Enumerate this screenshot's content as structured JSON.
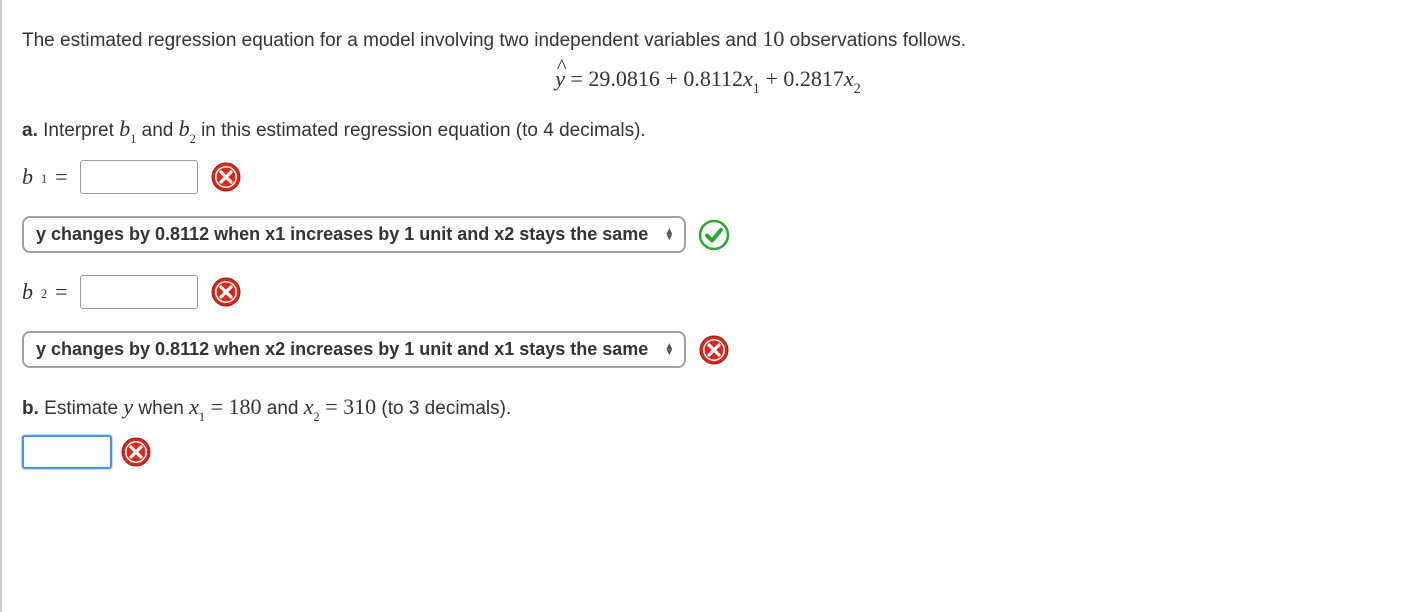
{
  "intro": {
    "pre": "The estimated regression equation for a model involving two independent variables and ",
    "n": "10",
    "post": " observations follows."
  },
  "equation": {
    "yhat": "ŷ",
    "eq": " = ",
    "c0": "29.0816",
    "plus1": " + ",
    "c1": "0.8112",
    "x1": "x",
    "x1s": "1",
    "plus2": " + ",
    "c2": "0.2817",
    "x2": "x",
    "x2s": "2"
  },
  "part_a": {
    "label": "a.",
    "text_pre": " Interpret ",
    "b1": "b",
    "b1s": "1",
    "and": " and ",
    "b2": "b",
    "b2s": "2",
    "text_post": " in this estimated regression equation (to 4 decimals)."
  },
  "b1_row": {
    "b": "b",
    "s": "1",
    "eq": "=",
    "value": ""
  },
  "select1": {
    "text": "y changes by 0.8112 when x1 increases by 1 unit and x2 stays the same"
  },
  "b2_row": {
    "b": "b",
    "s": "2",
    "eq": "=",
    "value": ""
  },
  "select2": {
    "text": "y changes by 0.8112 when x2 increases by 1 unit and x1 stays the same"
  },
  "part_b": {
    "label": "b.",
    "pre": " Estimate ",
    "y": "y",
    "mid1": " when ",
    "x1": "x",
    "x1s": "1",
    "eq1": " = ",
    "v1": "180",
    "and": " and ",
    "x2": "x",
    "x2s": "2",
    "eq2": " = ",
    "v2": "310",
    "post": " (to 3 decimals)."
  },
  "answer_b": {
    "value": ""
  }
}
